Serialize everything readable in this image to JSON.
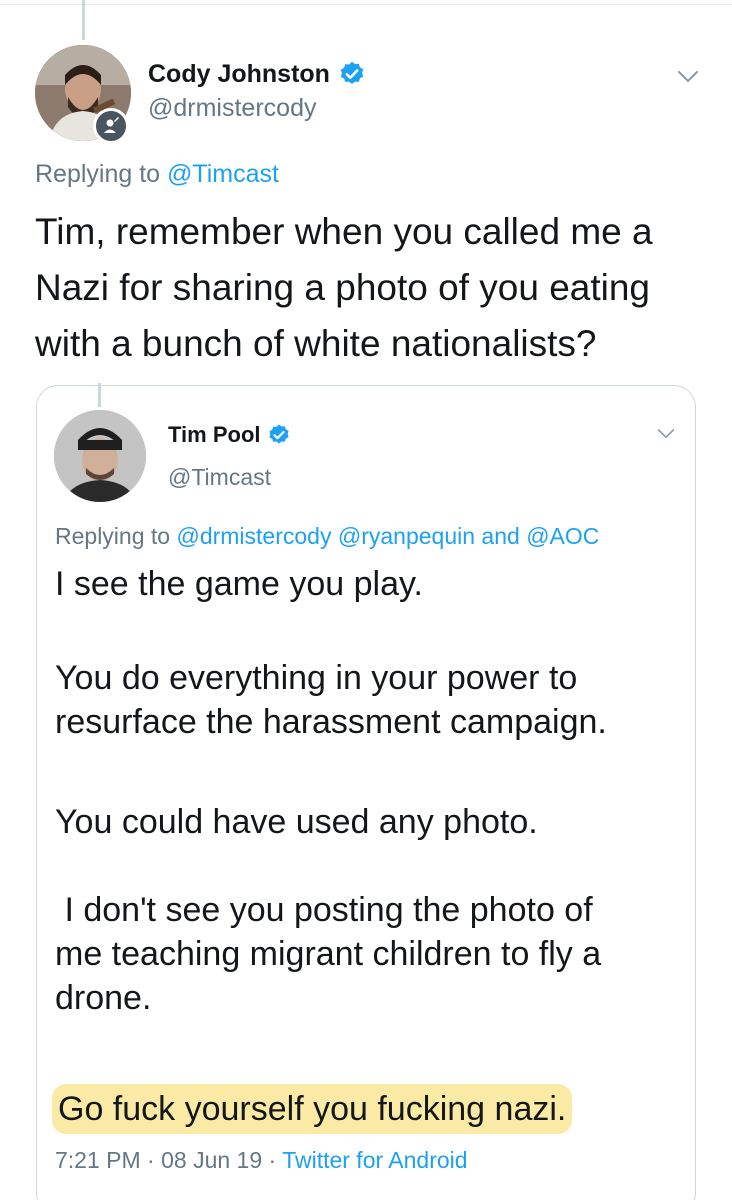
{
  "outer_tweet": {
    "display_name": "Cody Johnston",
    "handle": "@drmistercody",
    "replying_prefix": "Replying to",
    "replying_to": "@Timcast",
    "text_lines": [
      "Tim, remember when you called me a",
      "Nazi for sharing a photo of you eating",
      "with a bunch of white nationalists?"
    ],
    "icons": [
      "verified-badge-icon",
      "chevron-down-icon",
      "account-badge-icon"
    ]
  },
  "quoted_tweet": {
    "display_name": "Tim Pool",
    "handle": "@Timcast",
    "replying_prefix": "Replying to",
    "mention_1": "@drmistercody",
    "mention_2": "@ryanpequin",
    "and_word": "and",
    "mention_3": "@AOC",
    "paragraphs": {
      "p1": [
        "I see the game you play."
      ],
      "p2": [
        "You do everything in your power to",
        "resurface the harassment campaign."
      ],
      "p3": [
        "You could have used any photo."
      ],
      "p4": [
        " I don't see you posting the photo of",
        "me teaching migrant children to fly a",
        "drone."
      ]
    },
    "highlighted_text": "Go fuck yourself you fucking nazi.",
    "time": "7:21 PM",
    "separator": "·",
    "date": "08 Jun 19",
    "source": "Twitter for Android"
  },
  "colors": {
    "link_blue": "#1da1f2",
    "secondary_gray": "#657786",
    "border": "#ccd6dd",
    "highlight": "#fbeaa6"
  }
}
